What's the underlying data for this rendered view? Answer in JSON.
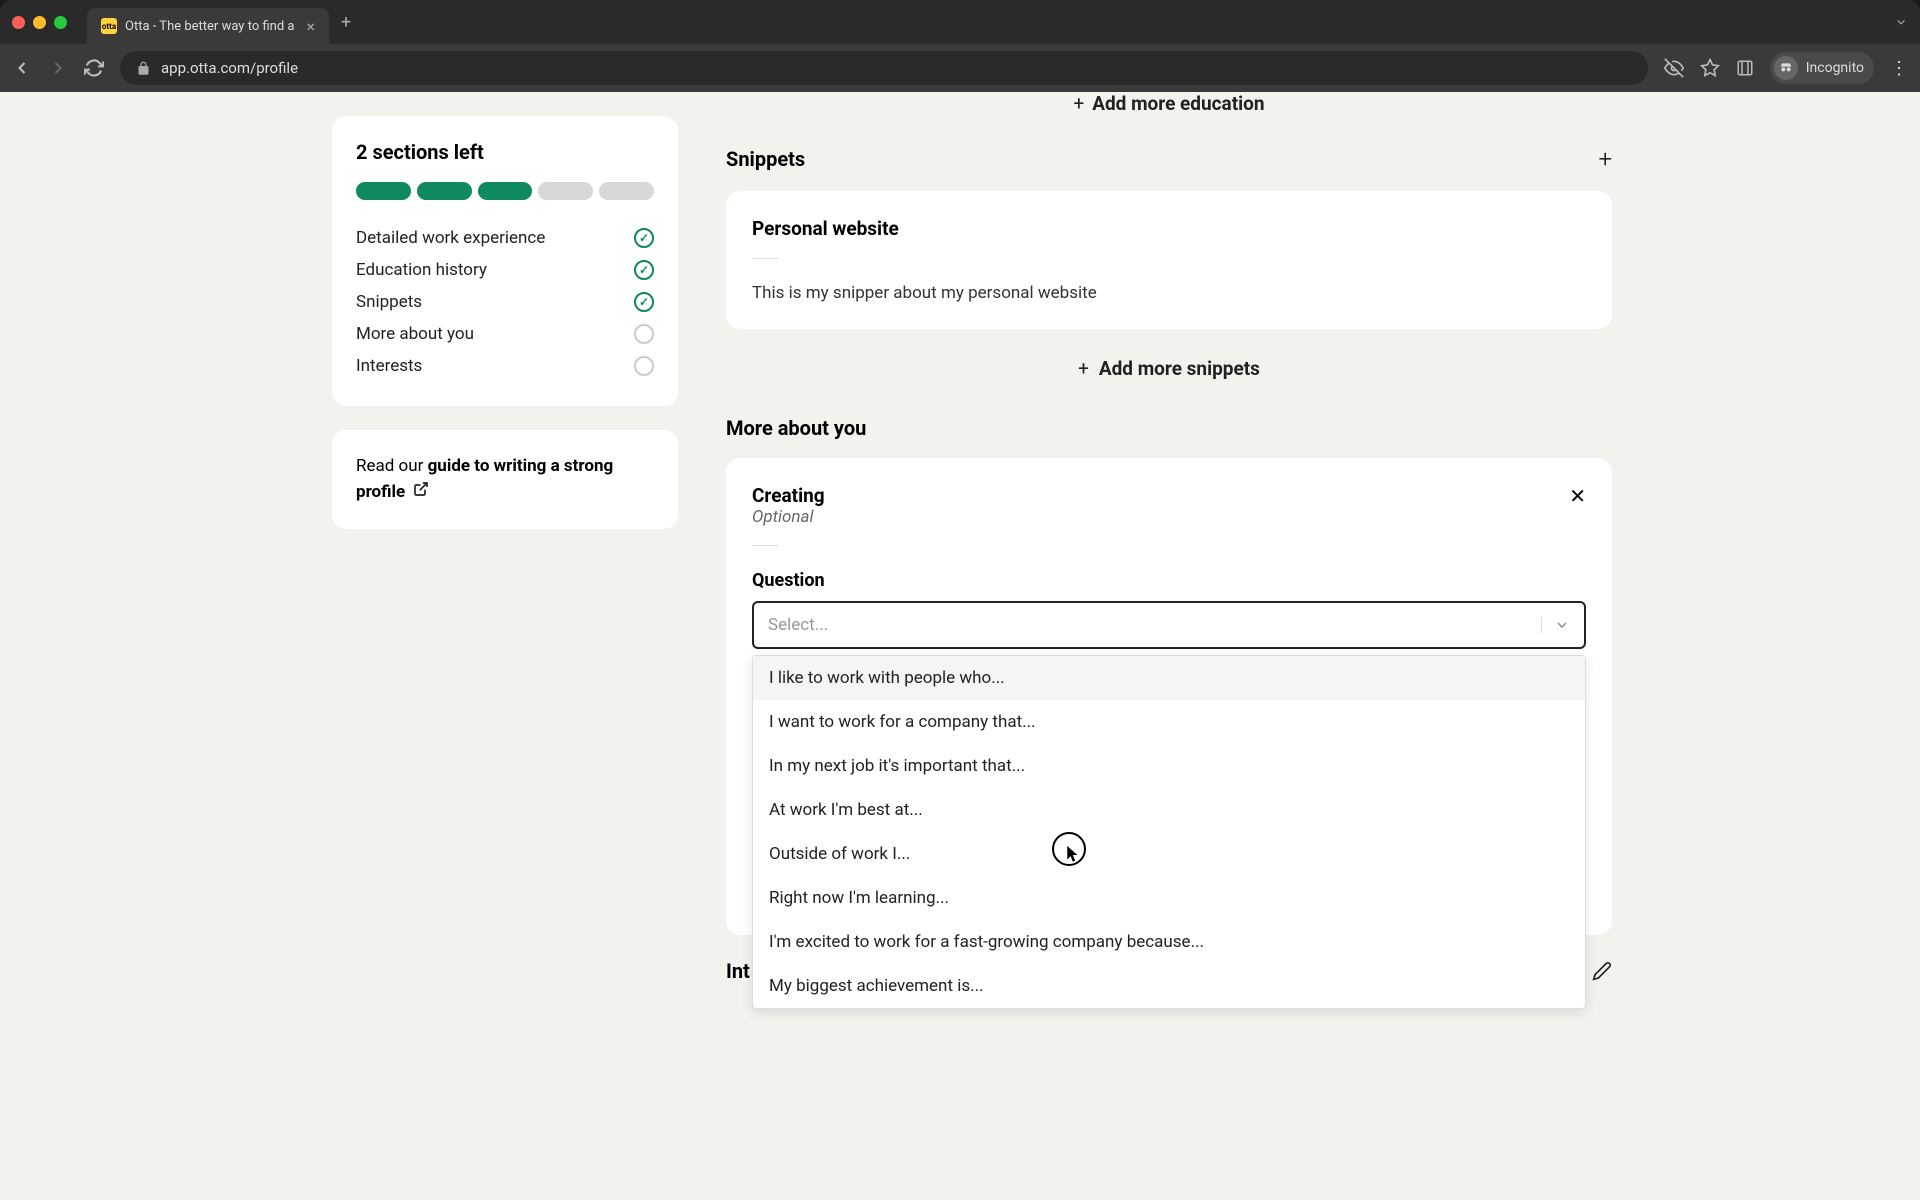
{
  "browser": {
    "tab_title": "Otta - The better way to find a",
    "url": "app.otta.com/profile",
    "incognito_label": "Incognito"
  },
  "sidebar": {
    "sections_left": "2 sections left",
    "items": [
      {
        "label": "Detailed work experience",
        "done": true
      },
      {
        "label": "Education history",
        "done": true
      },
      {
        "label": "Snippets",
        "done": true
      },
      {
        "label": "More about you",
        "done": false
      },
      {
        "label": "Interests",
        "done": false
      }
    ],
    "guide_prefix": "Read our ",
    "guide_link": "guide to writing a strong profile"
  },
  "main": {
    "add_education": "Add more education",
    "snippets_title": "Snippets",
    "snippet_card_title": "Personal website",
    "snippet_text": "This is my snipper about my personal website",
    "add_snippets": "Add more snippets",
    "more_about_you": "More about you",
    "creating_title": "Creating",
    "optional": "Optional",
    "question_label": "Question",
    "select_placeholder": "Select...",
    "interests": "Int",
    "dropdown": [
      "I like to work with people who...",
      "I want to work for a company that...",
      "In my next job it's important that...",
      "At work I'm best at...",
      "Outside of work I...",
      "Right now I'm learning...",
      "I'm excited to work for a fast-growing company because...",
      "My biggest achievement is..."
    ]
  }
}
